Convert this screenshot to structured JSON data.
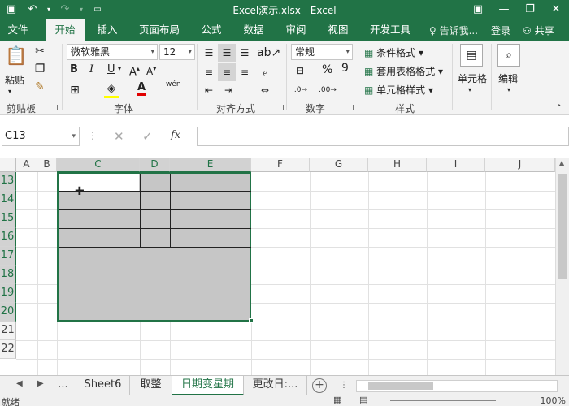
{
  "window": {
    "title": "Excel演示.xlsx - Excel"
  },
  "quick_access": {
    "save_icon": "save-icon",
    "undo_icon": "undo-icon",
    "redo_icon": "redo-icon",
    "customize_icon": "customize-icon"
  },
  "ribbon_tabs": [
    "文件",
    "开始",
    "插入",
    "页面布局",
    "公式",
    "数据",
    "审阅",
    "视图",
    "开发工具"
  ],
  "active_tab": "开始",
  "tell_me": "告诉我...",
  "login": "登录",
  "share": "共享",
  "clipboard": {
    "paste": "粘贴",
    "label": "剪贴板"
  },
  "font": {
    "name": "微软雅黑",
    "size": "12",
    "label": "字体",
    "bold": "B",
    "italic": "I",
    "underline": "U",
    "font_color": "A",
    "wen": "wén"
  },
  "alignment": {
    "label": "对齐方式"
  },
  "number": {
    "format": "常规",
    "label": "数字",
    "percent": "%",
    "comma": "9"
  },
  "styles": {
    "conditional": "条件格式",
    "table": "套用表格格式",
    "cell": "单元格样式",
    "label": "样式"
  },
  "cells": {
    "label": "单元格"
  },
  "editing": {
    "label": "编辑"
  },
  "formula_bar": {
    "name_box": "C13",
    "fx": "fx",
    "formula": ""
  },
  "columns": [
    "A",
    "B",
    "C",
    "D",
    "E",
    "F",
    "G",
    "H",
    "I",
    "J"
  ],
  "rows": [
    "13",
    "14",
    "15",
    "16",
    "17",
    "18",
    "19",
    "20",
    "21",
    "22"
  ],
  "sheets": {
    "ellipsis_left": "...",
    "tabs": [
      "Sheet6",
      "取整",
      "日期变星期",
      "更改日:..."
    ],
    "active": "日期变星期"
  },
  "status": {
    "ready": "就绪",
    "zoom": "100%"
  },
  "colors": {
    "accent": "#217346",
    "selection": "#c6c6c6"
  }
}
